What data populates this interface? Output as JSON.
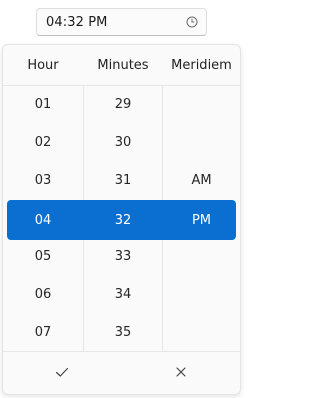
{
  "time_input": {
    "value": "04:32 PM",
    "icon": "clock-icon"
  },
  "picker": {
    "columns": {
      "hour": {
        "header": "Hour",
        "items": [
          "01",
          "02",
          "03",
          "04",
          "05",
          "06",
          "07"
        ],
        "selected": "04"
      },
      "minutes": {
        "header": "Minutes",
        "items": [
          "29",
          "30",
          "31",
          "32",
          "33",
          "34",
          "35"
        ],
        "selected": "32"
      },
      "meridiem": {
        "header": "Meridiem",
        "items": [
          "",
          "",
          "AM",
          "PM",
          "",
          "",
          ""
        ],
        "selected": "PM"
      }
    },
    "footer": {
      "accept_icon": "checkmark-icon",
      "dismiss_icon": "close-icon"
    }
  },
  "colors": {
    "selection": "#0a6fd1",
    "selection_text": "#ffffff",
    "text": "#262626"
  }
}
